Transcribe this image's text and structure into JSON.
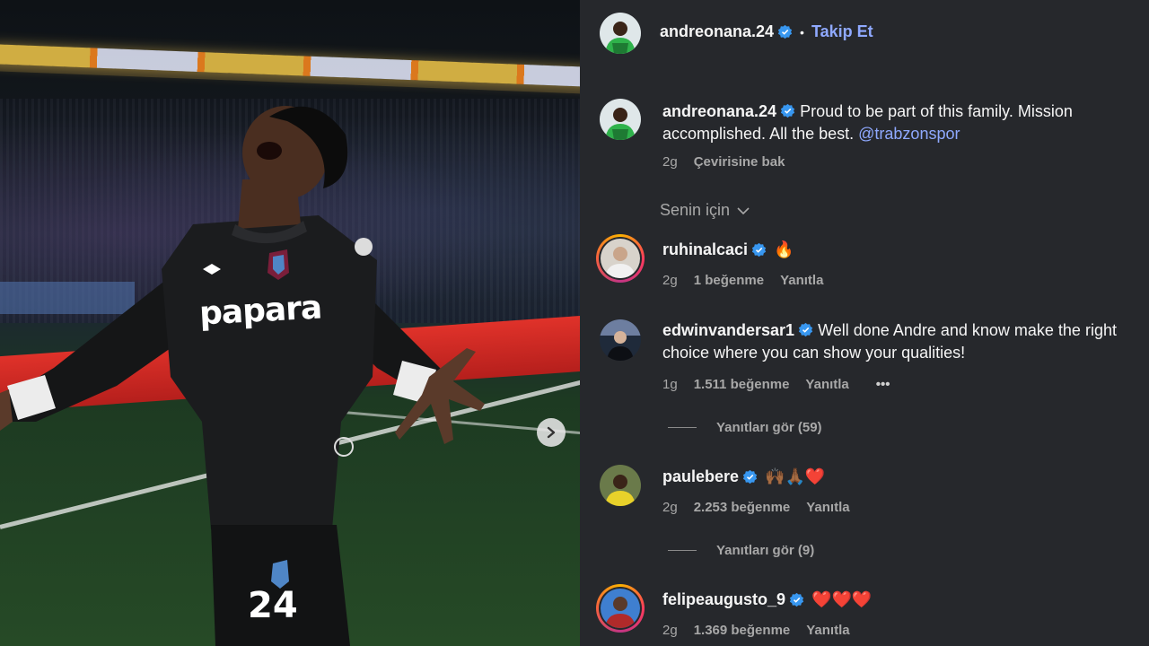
{
  "post": {
    "author": "andreonana.24",
    "follow_label": "Takip Et",
    "caption_text": "Proud to be part of this family. Mission accomplished. All the best.",
    "caption_mention": "@trabzonspor",
    "time": "2g",
    "translate_label": "Çevirisine bak"
  },
  "photo": {
    "sponsor_text": "papara",
    "shirt_number": "24"
  },
  "filter": {
    "label": "Senin için"
  },
  "comments": [
    {
      "user": "ruhinalcaci",
      "text": "🔥",
      "time": "2g",
      "likes": "1 beğenme",
      "reply": "Yanıtla"
    },
    {
      "user": "edwinvandersar1",
      "text": "Well done Andre and know make the right choice where you can show your qualities!",
      "time": "1g",
      "likes": "1.511 beğenme",
      "reply": "Yanıtla",
      "more": "•••",
      "view_replies": "Yanıtları gör (59)"
    },
    {
      "user": "paulebere",
      "text": "🙌🏾🙏🏾❤️",
      "time": "2g",
      "likes": "2.253 beğenme",
      "reply": "Yanıtla",
      "view_replies": "Yanıtları gör (9)"
    },
    {
      "user": "felipeaugusto_9",
      "text": "❤️❤️❤️",
      "time": "2g",
      "likes": "1.369 beğenme",
      "reply": "Yanıtla"
    }
  ],
  "colors": {
    "accent": "#8fa9ff",
    "verified": "#3897f0",
    "panel_bg": "#26282c",
    "muted": "#a8a8a8"
  },
  "icons": {
    "verified": "verified-badge-icon",
    "next": "chevron-right-icon",
    "filter": "chevron-down-icon"
  }
}
